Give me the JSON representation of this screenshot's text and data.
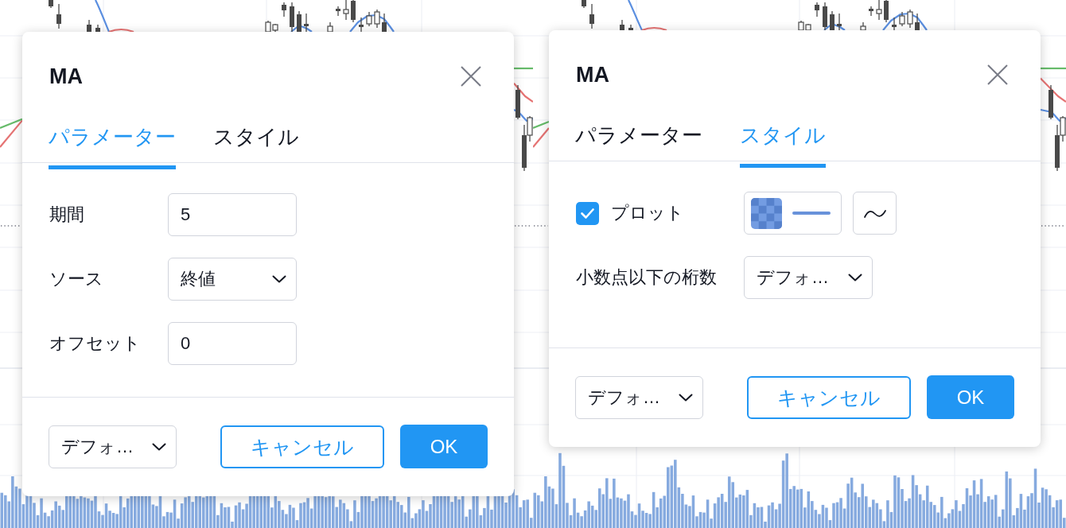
{
  "dialogs": [
    {
      "title": "MA",
      "tabs": [
        {
          "label": "パラメーター",
          "selected": true
        },
        {
          "label": "スタイル",
          "selected": false
        }
      ],
      "rows": [
        {
          "kind": "input",
          "label": "期間",
          "value": "5"
        },
        {
          "kind": "select",
          "label": "ソース",
          "value": "終値"
        },
        {
          "kind": "input",
          "label": "オフセット",
          "value": "0"
        }
      ],
      "footer": {
        "preset": "デフォ…",
        "cancel": "キャンセル",
        "ok": "OK"
      }
    },
    {
      "title": "MA",
      "tabs": [
        {
          "label": "パラメーター",
          "selected": false
        },
        {
          "label": "スタイル",
          "selected": true
        }
      ],
      "rows": [
        {
          "kind": "plot",
          "label": "プロット",
          "checked": true
        },
        {
          "kind": "select",
          "label": "小数点以下の桁数",
          "value": "デフォ…"
        }
      ],
      "footer": {
        "preset": "デフォ…",
        "cancel": "キャンセル",
        "ok": "OK"
      }
    }
  ]
}
